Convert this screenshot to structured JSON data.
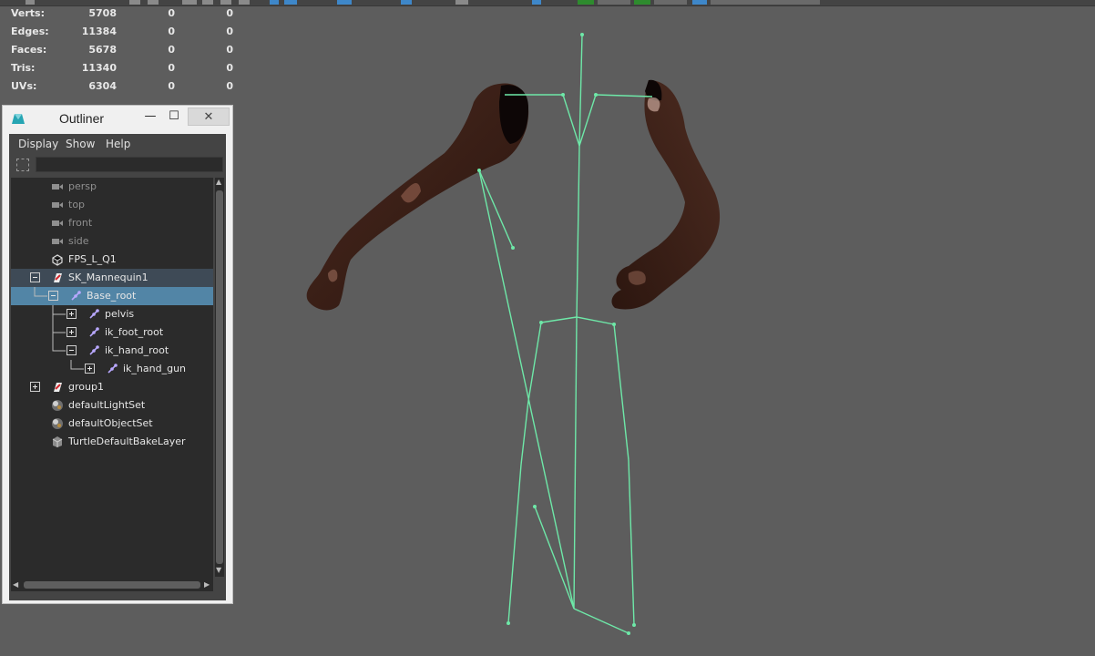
{
  "hud": {
    "rows": [
      {
        "label": "Verts:",
        "v1": "5708",
        "v2": "0",
        "v3": "0"
      },
      {
        "label": "Edges:",
        "v1": "11384",
        "v2": "0",
        "v3": "0"
      },
      {
        "label": "Faces:",
        "v1": "5678",
        "v2": "0",
        "v3": "0"
      },
      {
        "label": "Tris:",
        "v1": "11340",
        "v2": "0",
        "v3": "0"
      },
      {
        "label": "UVs:",
        "v1": "6304",
        "v2": "0",
        "v3": "0"
      }
    ]
  },
  "outliner": {
    "title": "Outliner",
    "minimize_glyph": "—",
    "maximize_glyph": "☐",
    "close_glyph": "✕",
    "menus": [
      "Display",
      "Show",
      "Help"
    ],
    "search_value": "",
    "items": [
      {
        "label": "persp",
        "icon": "camera-icon",
        "dim": true
      },
      {
        "label": "top",
        "icon": "camera-icon",
        "dim": true
      },
      {
        "label": "front",
        "icon": "camera-icon",
        "dim": true
      },
      {
        "label": "side",
        "icon": "camera-icon",
        "dim": true
      },
      {
        "label": "FPS_L_Q1",
        "icon": "mesh-icon",
        "dim": false
      },
      {
        "label": "SK_Mannequin1",
        "icon": "skeleton-group-icon",
        "dim": false,
        "expander": "minus"
      },
      {
        "label": "Base_root",
        "icon": "joint-icon",
        "dim": false,
        "expander": "minus",
        "selected": true
      },
      {
        "label": "pelvis",
        "icon": "joint-icon",
        "dim": false,
        "expander": "plus"
      },
      {
        "label": "ik_foot_root",
        "icon": "joint-icon",
        "dim": false,
        "expander": "plus"
      },
      {
        "label": "ik_hand_root",
        "icon": "joint-icon",
        "dim": false,
        "expander": "minus"
      },
      {
        "label": "ik_hand_gun",
        "icon": "joint-icon",
        "dim": false,
        "expander": "plus"
      },
      {
        "label": "group1",
        "icon": "skeleton-group-icon",
        "dim": false,
        "expander": "plus"
      },
      {
        "label": "defaultLightSet",
        "icon": "set-icon",
        "dim": false
      },
      {
        "label": "defaultObjectSet",
        "icon": "set-icon",
        "dim": false
      },
      {
        "label": "TurtleDefaultBakeLayer",
        "icon": "bake-layer-icon",
        "dim": false
      }
    ]
  },
  "colors": {
    "viewport_bg": "#5d5d5d",
    "skeleton": "#6ee8a8",
    "skin": "#3b1f17",
    "selection": "#5285a6"
  }
}
